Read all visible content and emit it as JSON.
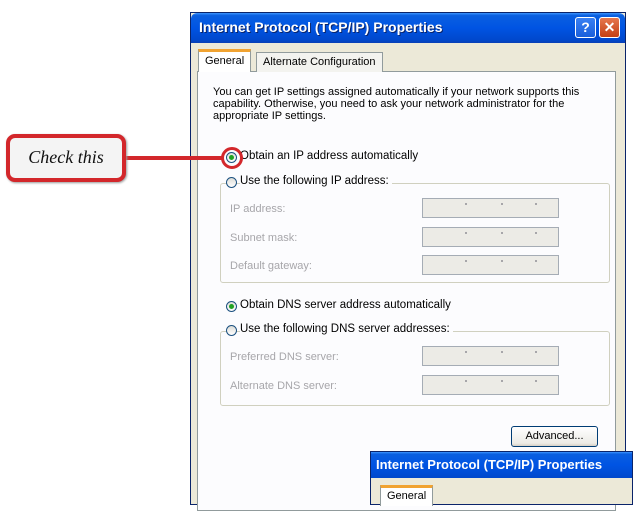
{
  "window": {
    "title": "Internet Protocol (TCP/IP) Properties",
    "help_glyph": "?",
    "close_glyph": "✕"
  },
  "tabs": {
    "general": "General",
    "alternate": "Alternate Configuration"
  },
  "description": "You can get IP settings assigned automatically if your network supports this capability. Otherwise, you need to ask your network administrator for the appropriate IP settings.",
  "ip_options": {
    "auto_label": "Obtain an IP address automatically",
    "manual_label": "Use the following IP address:",
    "auto_selected": true
  },
  "ip_fields": {
    "ip_address": "IP address:",
    "subnet_mask": "Subnet mask:",
    "default_gateway": "Default gateway:"
  },
  "dns_options": {
    "auto_label": "Obtain DNS server address automatically",
    "manual_label": "Use the following DNS server addresses:",
    "auto_selected": true
  },
  "dns_fields": {
    "preferred": "Preferred DNS server:",
    "alternate": "Alternate DNS server:"
  },
  "advanced_button": "Advanced...",
  "second_window": {
    "title": "Internet Protocol (TCP/IP) Properties",
    "tab": "General"
  },
  "callout": {
    "text": "Check this",
    "color": "#d3272b"
  }
}
